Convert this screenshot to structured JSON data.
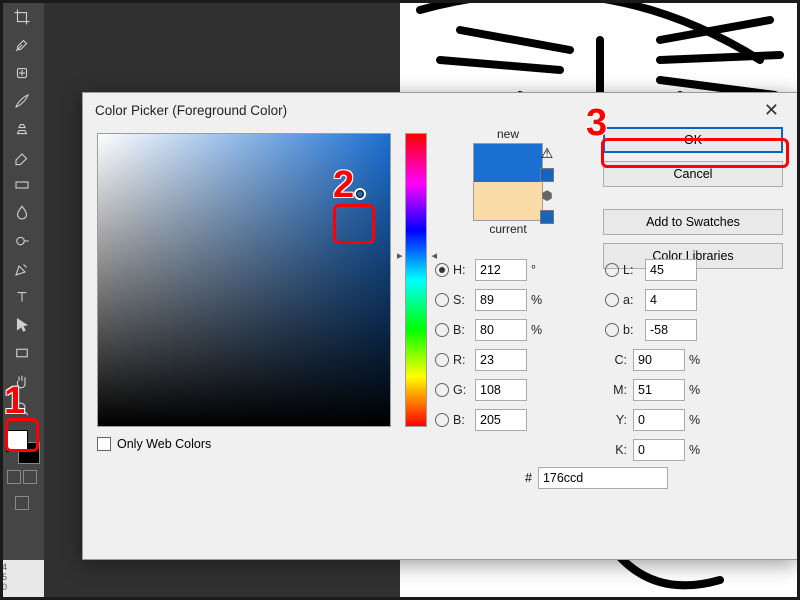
{
  "dialog": {
    "title": "Color Picker (Foreground Color)",
    "new_label": "new",
    "current_label": "current",
    "ok": "OK",
    "cancel": "Cancel",
    "add_swatches": "Add to Swatches",
    "color_libraries": "Color Libraries",
    "only_web_colors": "Only Web Colors",
    "hex_prefix": "#",
    "hex": "176ccd",
    "hsb": {
      "h_label": "H:",
      "h": "212",
      "h_unit": "°",
      "s_label": "S:",
      "s": "89",
      "s_unit": "%",
      "b_label": "B:",
      "b": "80",
      "b_unit": "%"
    },
    "rgb": {
      "r_label": "R:",
      "r": "23",
      "g_label": "G:",
      "g": "108",
      "b_label": "B:",
      "b": "205"
    },
    "lab": {
      "l_label": "L:",
      "l": "45",
      "a_label": "a:",
      "a": "4",
      "b_label": "b:",
      "b": "-58"
    },
    "cmyk": {
      "c_label": "C:",
      "c": "90",
      "m_label": "M:",
      "m": "51",
      "y_label": "Y:",
      "y": "0",
      "k_label": "K:",
      "k": "0",
      "unit": "%"
    },
    "new_color": "#1b6fd1",
    "current_color": "#fbdca8"
  },
  "annotations": {
    "one": "1",
    "two": "2",
    "three": "3"
  },
  "ruler": {
    "a": "4",
    "b": "5",
    "c": "0"
  }
}
